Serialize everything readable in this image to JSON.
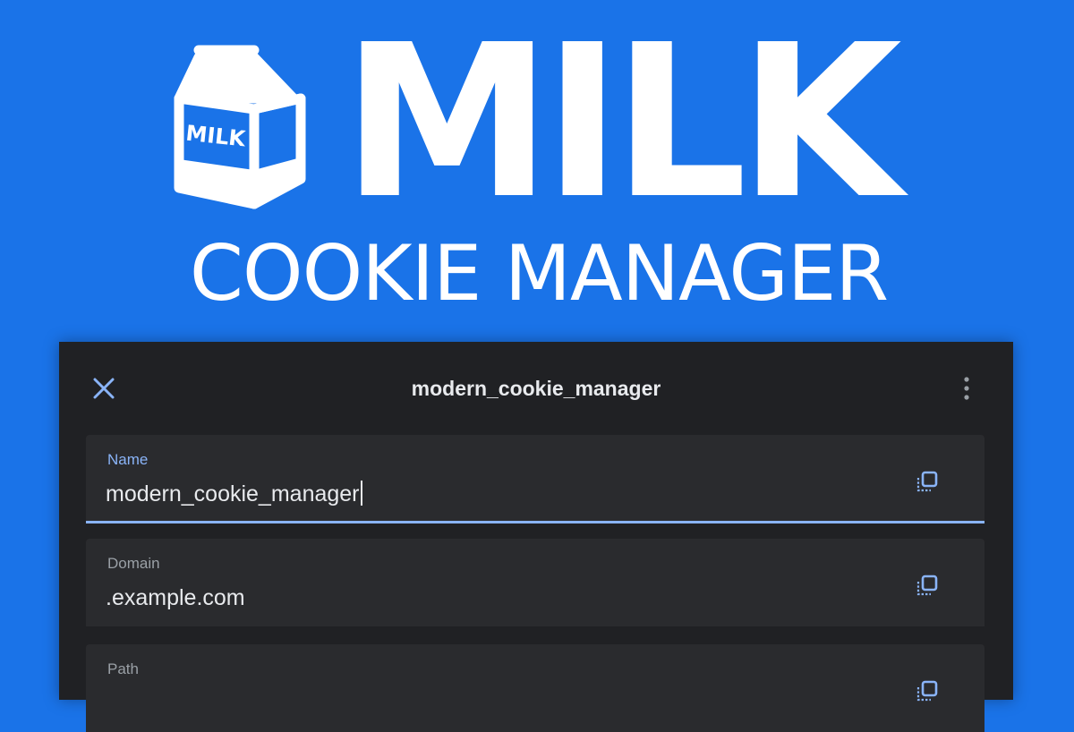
{
  "brand": {
    "logo_text": "MILK",
    "title": "MILK",
    "subtitle": "COOKIE MANAGER"
  },
  "dialog": {
    "title": "modern_cookie_manager",
    "close_icon": "close-icon",
    "menu_icon": "more-vert-icon"
  },
  "fields": {
    "name": {
      "label": "Name",
      "value": "modern_cookie_manager"
    },
    "domain": {
      "label": "Domain",
      "value": ".example.com"
    },
    "path": {
      "label": "Path",
      "value": ""
    }
  },
  "colors": {
    "background": "#1a73e8",
    "panel": "#202124",
    "field": "#2a2b2e",
    "accent": "#8ab4f8",
    "text": "#e8eaed",
    "label": "#9aa0a6"
  }
}
